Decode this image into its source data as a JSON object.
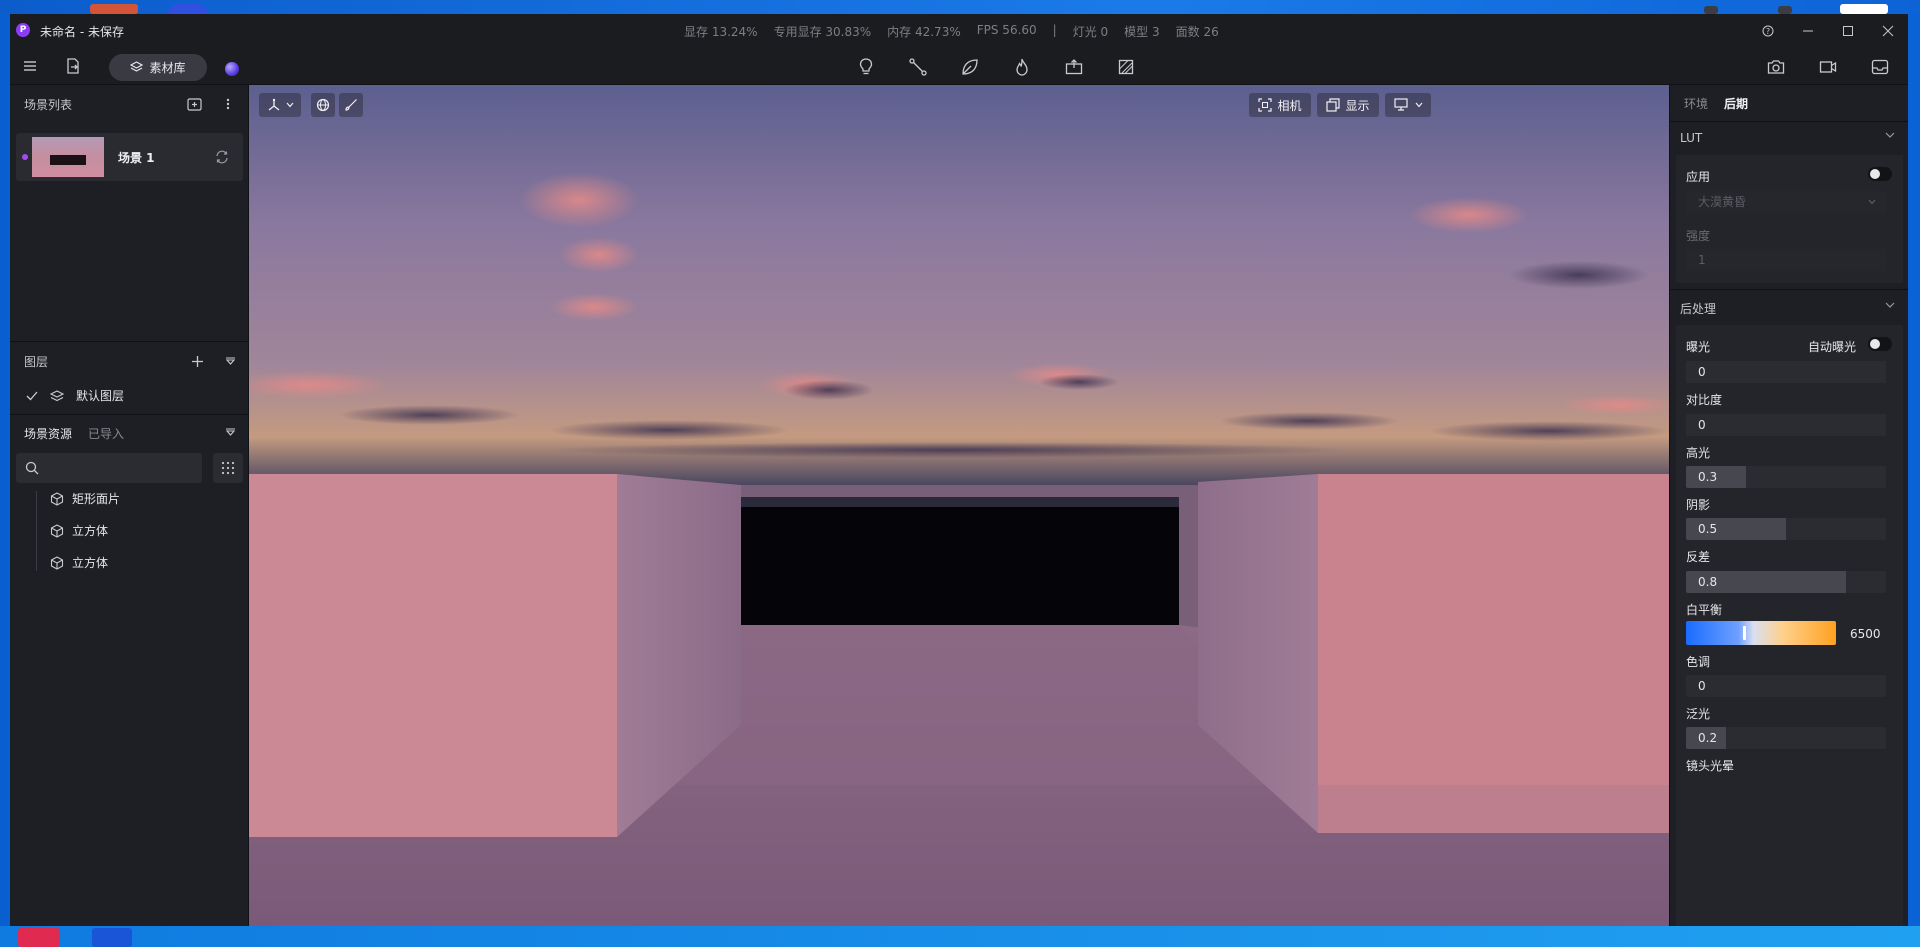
{
  "window": {
    "title": "未命名 - 未保存",
    "stats": [
      "显存 13.24%",
      "专用显存 30.83%",
      "内存 42.73%",
      "FPS 56.60",
      "|",
      "灯光 0",
      "模型 3",
      "面数 26"
    ]
  },
  "toolbar": {
    "library_label": "素材库"
  },
  "sidebar": {
    "scene_list_title": "场景列表",
    "scenes": [
      {
        "name": "场景 1"
      }
    ],
    "layers_title": "图层",
    "layers": [
      {
        "name": "默认图层"
      }
    ],
    "assets_tabs": [
      "场景资源",
      "已导入"
    ],
    "search_placeholder": "",
    "assets": [
      {
        "name": "矩形面片"
      },
      {
        "name": "立方体"
      },
      {
        "name": "立方体"
      }
    ]
  },
  "viewport": {
    "camera_label": "相机",
    "display_label": "显示"
  },
  "right_panel": {
    "tabs": [
      "环境",
      "后期"
    ],
    "active_tab": "后期",
    "lut": {
      "title": "LUT",
      "apply_label": "应用",
      "apply_on": false,
      "preset": "大漠黄昏",
      "strength_label": "强度",
      "strength_value": "1"
    },
    "post": {
      "title": "后处理",
      "exposure_label": "曝光",
      "auto_exposure_label": "自动曝光",
      "auto_exposure_on": false,
      "exposure_value": "0",
      "contrast_label": "对比度",
      "contrast_value": "0",
      "highlight_label": "高光",
      "highlight_value": "0.3",
      "shadow_label": "阴影",
      "shadow_value": "0.5",
      "reflect_label": "反差",
      "reflect_value": "0.8",
      "white_balance_label": "白平衡",
      "white_balance_value": "6500",
      "tint_label": "色调",
      "tint_value": "0",
      "bloom_label": "泛光",
      "bloom_value": "0.2",
      "lens_flare_label": "镜头光晕"
    }
  },
  "colors": {
    "app_bg": "#1b1c20",
    "panel_bg": "#1e1f24",
    "accent_purple": "#8b3df5",
    "desktop_blue": "#1e7ef0"
  }
}
